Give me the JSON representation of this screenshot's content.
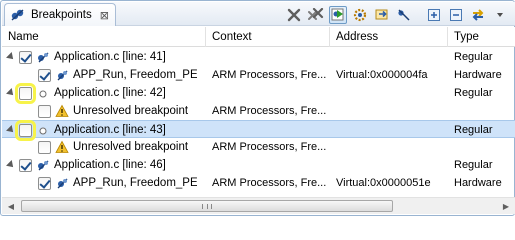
{
  "view": {
    "tab_title": "Breakpoints",
    "close_glyph": "⊠"
  },
  "toolbar": {
    "buttons": [
      {
        "icon": "remove-breakpoint-icon"
      },
      {
        "icon": "remove-all-breakpoints-icon"
      },
      {
        "icon": "show-supported-breakpoints-icon",
        "active": true
      },
      {
        "icon": "go-to-file-icon"
      },
      {
        "icon": "skip-all-breakpoints-icon"
      },
      {
        "icon": "link-with-debug-view-icon"
      },
      {
        "icon": "expand-all-icon"
      },
      {
        "icon": "collapse-all-icon"
      },
      {
        "icon": "link-editor-icon"
      },
      {
        "icon": "view-menu-icon"
      }
    ]
  },
  "table": {
    "columns": [
      "Name",
      "Context",
      "Address",
      "Type"
    ],
    "rows": [
      {
        "level": 0,
        "checked": true,
        "highlight": false,
        "icon": "line-breakpoint-icon",
        "name": "Application.c [line: 41]",
        "context": "",
        "address": "",
        "type": "Regular"
      },
      {
        "level": 1,
        "checked": true,
        "highlight": false,
        "icon": "installed-breakpoint-icon",
        "name": "APP_Run, Freedom_PE",
        "context": "ARM Processors, Fre...",
        "address": "Virtual:0x000004fa",
        "type": "Hardware"
      },
      {
        "level": 0,
        "checked": false,
        "highlight": true,
        "icon": "disabled-breakpoint-icon",
        "name": "Application.c [line: 42]",
        "context": "",
        "address": "",
        "type": "Regular"
      },
      {
        "level": 1,
        "checked": false,
        "highlight": false,
        "icon": "warning-icon",
        "name": "Unresolved breakpoint",
        "context": "ARM Processors, Fre...",
        "address": "",
        "type": ""
      },
      {
        "level": 0,
        "checked": false,
        "highlight": true,
        "selected": true,
        "icon": "disabled-breakpoint-icon",
        "name": "Application.c [line: 43]",
        "context": "",
        "address": "",
        "type": "Regular"
      },
      {
        "level": 1,
        "checked": false,
        "highlight": false,
        "icon": "warning-icon",
        "name": "Unresolved breakpoint",
        "context": "ARM Processors, Fre...",
        "address": "",
        "type": ""
      },
      {
        "level": 0,
        "checked": true,
        "highlight": false,
        "icon": "line-breakpoint-icon",
        "name": "Application.c [line: 46]",
        "context": "",
        "address": "",
        "type": "Regular"
      },
      {
        "level": 1,
        "checked": true,
        "highlight": false,
        "icon": "installed-breakpoint-icon",
        "name": "APP_Run, Freedom_PE",
        "context": "ARM Processors, Fre...",
        "address": "Virtual:0x0000051e",
        "type": "Hardware"
      }
    ]
  },
  "colors": {
    "selection": "#cfe3f9",
    "highlight": "#f7f34a",
    "breakpoint_blue": "#2b5ea8"
  }
}
